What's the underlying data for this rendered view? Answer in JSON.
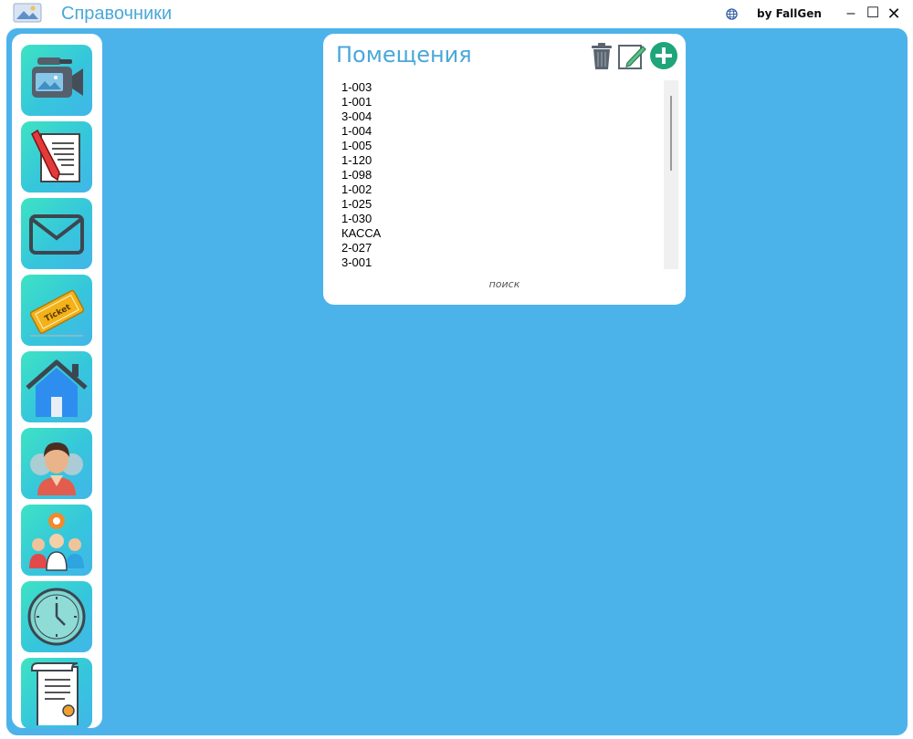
{
  "window": {
    "title": "Справочники",
    "author": "by FallGen",
    "minimize": "–",
    "maximize": "☐",
    "close": "✕"
  },
  "sidebar": {
    "items": [
      {
        "icon": "video-camera-icon"
      },
      {
        "icon": "document-pen-icon"
      },
      {
        "icon": "envelope-icon"
      },
      {
        "icon": "ticket-icon",
        "text": "Ticket"
      },
      {
        "icon": "house-icon"
      },
      {
        "icon": "person-icon"
      },
      {
        "icon": "team-settings-icon"
      },
      {
        "icon": "clock-icon"
      },
      {
        "icon": "certificate-scroll-icon"
      }
    ]
  },
  "panel": {
    "title": "Помещения",
    "search_label": "поиск",
    "rooms": [
      "1-003",
      "1-001",
      "3-004",
      "1-004",
      "1-005",
      "1-120",
      "1-098",
      "1-002",
      "1-025",
      "1-030",
      "КАССА",
      "2-027",
      "3-001"
    ]
  },
  "colors": {
    "background": "#4cb3ea",
    "accent": "#4aa8d8",
    "add_button": "#1fa57a"
  }
}
